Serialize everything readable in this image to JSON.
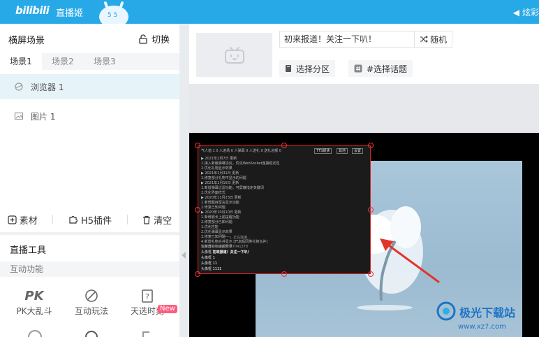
{
  "topbar": {
    "logo": "bilibili",
    "app_name": "直播姬",
    "right_text": "炫彩"
  },
  "scene_panel": {
    "title": "横屏场景",
    "switch_label": "切换",
    "tabs": [
      {
        "label": "场景1"
      },
      {
        "label": "场景2"
      },
      {
        "label": "场景3"
      }
    ],
    "items": [
      {
        "label": "浏览器 1"
      },
      {
        "label": "图片 1"
      }
    ],
    "toolbar": {
      "material": "素材",
      "h5_plugin": "H5插件",
      "clear": "清空"
    }
  },
  "tools_panel": {
    "title": "直播工具",
    "section": "互动功能",
    "tools": [
      {
        "label": "PK大乱斗"
      },
      {
        "label": "互动玩法"
      },
      {
        "label": "天选时刻"
      }
    ],
    "new_badge": "New"
  },
  "info": {
    "title_value": "初来报道！关注一下叭！",
    "random_label": "随机",
    "category_label": "选择分区",
    "topic_label": "#选择话题"
  },
  "overlay": {
    "header": "气人值 1  0 人进场  0 人弹幕  0 人送礼  0 送礼总额 0",
    "buttons": [
      "TTS朗读",
      "其他",
      "设置"
    ],
    "lines": [
      "▶ 2021年2月7日 更新",
      "1.接入新版弹幕协议，优化WebSocket连接稳定性",
      "2.优化礼物显示效果",
      "▶ 2021年1月31日 更新",
      "1.修复部分礼物不显示的问题",
      "▶ 2021年1月16日 更新",
      "1.新增弹幕过滤功能，可屏蔽指定关键词",
      "2.优化界面样式",
      "▶ 2020年11月23日 更新",
      "1.新增醒目留言显示功能",
      "2.修复已知问题",
      "▶ 2020年10月10日 更新",
      "1.新增舰长上船提醒功能",
      "2.修复部分已知问题",
      "1.优化性能",
      "2.优化弹幕显示效果",
      "3.修复已知问题",
      "4.新增礼物合并显示 [开启后同类礼物合并]",
      "5.新增礼物动画效果"
    ],
    "separator": "「一一」正在连接...",
    "notice": "连接成功，房间号 27041378",
    "danmaku": [
      {
        "user": "头像框",
        "text": "初来报道！关注一下叭！"
      },
      {
        "user": "头像框",
        "text": "1"
      },
      {
        "user": "头像框",
        "text": "11"
      },
      {
        "user": "头像框",
        "text": "1111"
      }
    ]
  },
  "watermark": {
    "brand": "极光下载站",
    "url": "www.xz7.com"
  }
}
